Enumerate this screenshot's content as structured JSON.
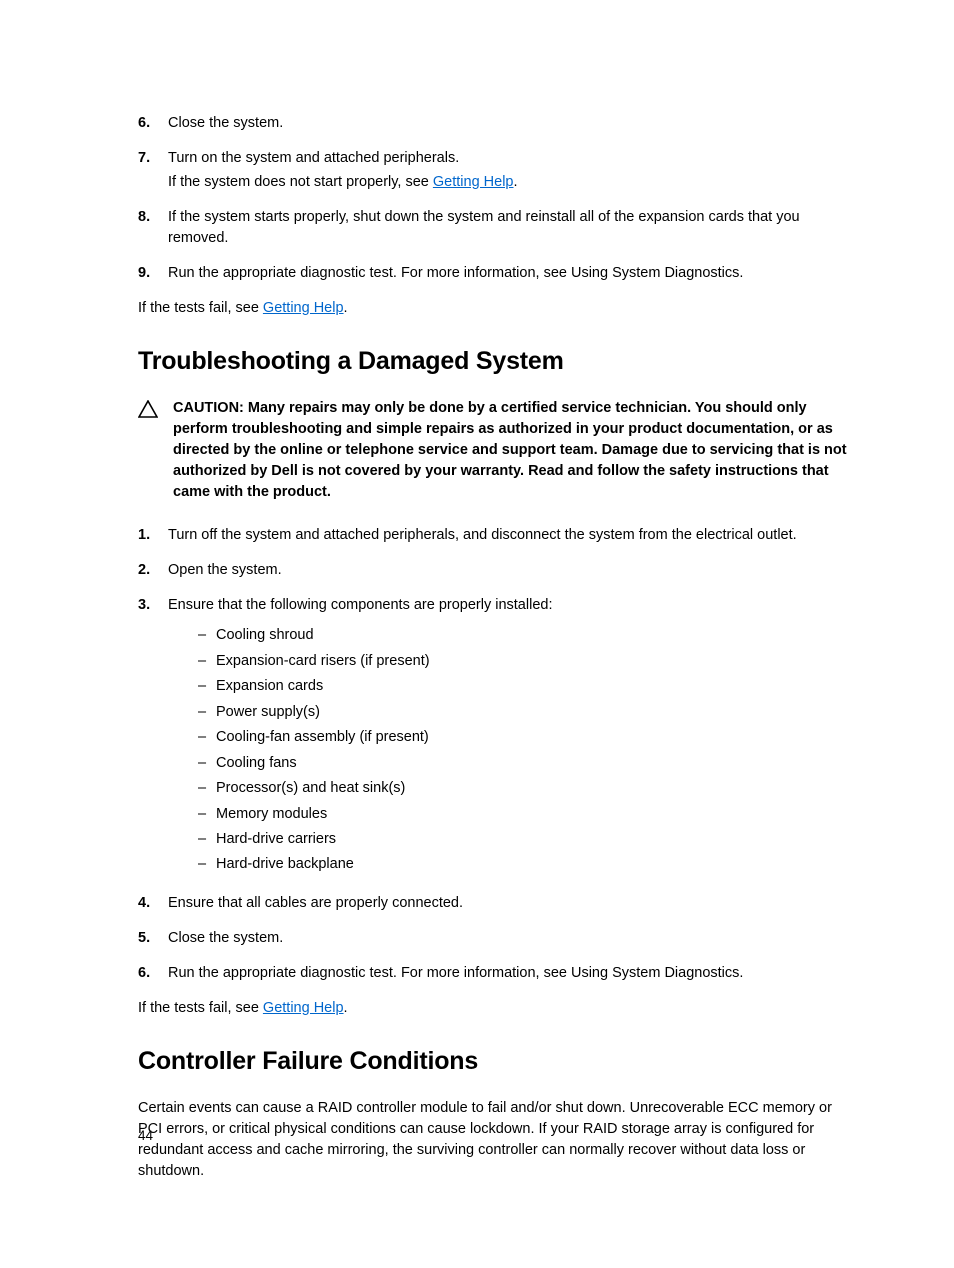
{
  "top_steps": [
    {
      "num": "6.",
      "text": "Close the system."
    },
    {
      "num": "7.",
      "text": "Turn on the system and attached peripherals.",
      "subtext_pre": "If the system does not start properly, see ",
      "link": "Getting Help",
      "subtext_post": "."
    },
    {
      "num": "8.",
      "text": "If the system starts properly, shut down the system and reinstall all of the expansion cards that you removed."
    },
    {
      "num": "9.",
      "text": "Run the appropriate diagnostic test. For more information, see Using System Diagnostics."
    }
  ],
  "top_tail_pre": "If the tests fail, see ",
  "top_tail_link": "Getting Help",
  "top_tail_post": ".",
  "heading1": "Troubleshooting a Damaged System",
  "caution": "CAUTION: Many repairs may only be done by a certified service technician. You should only perform troubleshooting and simple repairs as authorized in your product documentation, or as directed by the online or telephone service and support team. Damage due to servicing that is not authorized by Dell is not covered by your warranty. Read and follow the safety instructions that came with the product.",
  "mid_steps": [
    {
      "num": "1.",
      "text": "Turn off the system and attached peripherals, and disconnect the system from the electrical outlet."
    },
    {
      "num": "2.",
      "text": "Open the system."
    },
    {
      "num": "3.",
      "text": "Ensure that the following components are properly installed:"
    },
    {
      "num": "4.",
      "text": "Ensure that all cables are properly connected."
    },
    {
      "num": "5.",
      "text": "Close the system."
    },
    {
      "num": "6.",
      "text": "Run the appropriate diagnostic test. For more information, see Using System Diagnostics."
    }
  ],
  "components": [
    "Cooling shroud",
    "Expansion-card risers (if present)",
    "Expansion cards",
    "Power supply(s)",
    "Cooling-fan assembly (if present)",
    "Cooling fans",
    "Processor(s) and heat sink(s)",
    "Memory modules",
    "Hard-drive carriers",
    "Hard-drive backplane"
  ],
  "mid_tail_pre": "If the tests fail, see ",
  "mid_tail_link": "Getting Help",
  "mid_tail_post": ".",
  "heading2": "Controller Failure Conditions",
  "controller_para": "Certain events can cause a RAID controller module to fail and/or shut down. Unrecoverable ECC memory or PCI errors, or critical physical conditions can cause lockdown. If your RAID storage array is configured for redundant access and cache mirroring, the surviving controller can normally recover without data loss or shutdown.",
  "page_number": "44"
}
